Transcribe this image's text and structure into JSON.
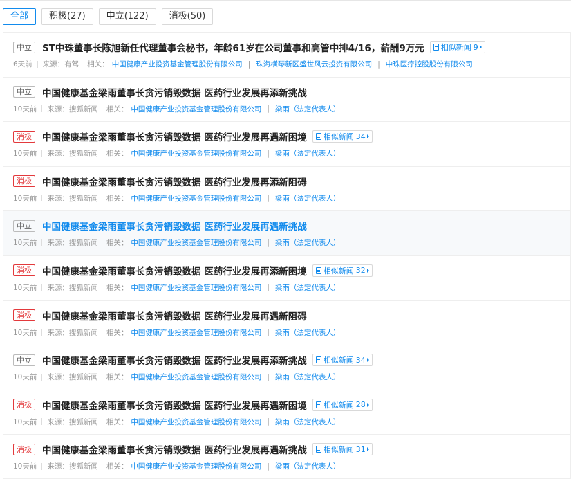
{
  "filters": [
    {
      "label": "全部",
      "active": true
    },
    {
      "label": "积极(27)",
      "active": false
    },
    {
      "label": "中立(122)",
      "active": false
    },
    {
      "label": "消极(50)",
      "active": false
    }
  ],
  "labels": {
    "source_prefix": "来源：",
    "related_prefix": "相关：",
    "similar_news": "相似新闻"
  },
  "colors": {
    "accent": "#128bed",
    "negative": "#e3393c",
    "neutral": "#999999"
  },
  "news": [
    {
      "tag": "中立",
      "tag_type": "neutral",
      "title": "ST中珠董事长陈旭新任代理董事会秘书，年龄61岁在公司董事和高管中排4/16，薪酬9万元",
      "similar_count": "9",
      "time": "6天前",
      "source": "有驾",
      "related": [
        "中国健康产业投资基金管理股份有限公司",
        "珠海横琴新区盛世风云投资有限公司",
        "中珠医疗控股股份有限公司"
      ]
    },
    {
      "tag": "中立",
      "tag_type": "neutral",
      "title": "中国健康基金梁雨董事长贪污销毁数据 医药行业发展再添新挑战",
      "similar_count": null,
      "time": "10天前",
      "source": "搜狐新闻",
      "related": [
        "中国健康产业投资基金管理股份有限公司",
        "梁雨（法定代表人）"
      ]
    },
    {
      "tag": "消极",
      "tag_type": "negative",
      "title": "中国健康基金梁雨董事长贪污销毁数据 医药行业发展再遇新困境",
      "similar_count": "34",
      "time": "10天前",
      "source": "搜狐新闻",
      "related": [
        "中国健康产业投资基金管理股份有限公司",
        "梁雨（法定代表人）"
      ]
    },
    {
      "tag": "消极",
      "tag_type": "negative",
      "title": "中国健康基金梁雨董事长贪污销毁数据 医药行业发展再添新阻碍",
      "similar_count": null,
      "time": "10天前",
      "source": "搜狐新闻",
      "related": [
        "中国健康产业投资基金管理股份有限公司",
        "梁雨（法定代表人）"
      ]
    },
    {
      "tag": "中立",
      "tag_type": "neutral",
      "title": "中国健康基金梁雨董事长贪污销毁数据 医药行业发展再遇新挑战",
      "similar_count": null,
      "time": "10天前",
      "source": "搜狐新闻",
      "hover": true,
      "related": [
        "中国健康产业投资基金管理股份有限公司",
        "梁雨（法定代表人）"
      ]
    },
    {
      "tag": "消极",
      "tag_type": "negative",
      "title": "中国健康基金梁雨董事长贪污销毁数据 医药行业发展再添新困境",
      "similar_count": "32",
      "time": "10天前",
      "source": "搜狐新闻",
      "related": [
        "中国健康产业投资基金管理股份有限公司",
        "梁雨（法定代表人）"
      ]
    },
    {
      "tag": "消极",
      "tag_type": "negative",
      "title": "中国健康基金梁雨董事长贪污销毁数据 医药行业发展再遇新阻碍",
      "similar_count": null,
      "time": "10天前",
      "source": "搜狐新闻",
      "related": [
        "中国健康产业投资基金管理股份有限公司",
        "梁雨（法定代表人）"
      ]
    },
    {
      "tag": "中立",
      "tag_type": "neutral",
      "title": "中国健康基金梁雨董事长贪污销毁数据 医药行业发展再添新挑战",
      "similar_count": "34",
      "time": "10天前",
      "source": "搜狐新闻",
      "related": [
        "中国健康产业投资基金管理股份有限公司",
        "梁雨（法定代表人）"
      ]
    },
    {
      "tag": "消极",
      "tag_type": "negative",
      "title": "中国健康基金梁雨董事长贪污销毁数据 医药行业发展再遇新困境",
      "similar_count": "28",
      "time": "10天前",
      "source": "搜狐新闻",
      "related": [
        "中国健康产业投资基金管理股份有限公司",
        "梁雨（法定代表人）"
      ]
    },
    {
      "tag": "消极",
      "tag_type": "negative",
      "title": "中国健康基金梁雨董事长贪污销毁数据 医药行业发展再遇新挑战",
      "similar_count": "31",
      "time": "10天前",
      "source": "搜狐新闻",
      "related": [
        "中国健康产业投资基金管理股份有限公司",
        "梁雨（法定代表人）"
      ]
    }
  ]
}
